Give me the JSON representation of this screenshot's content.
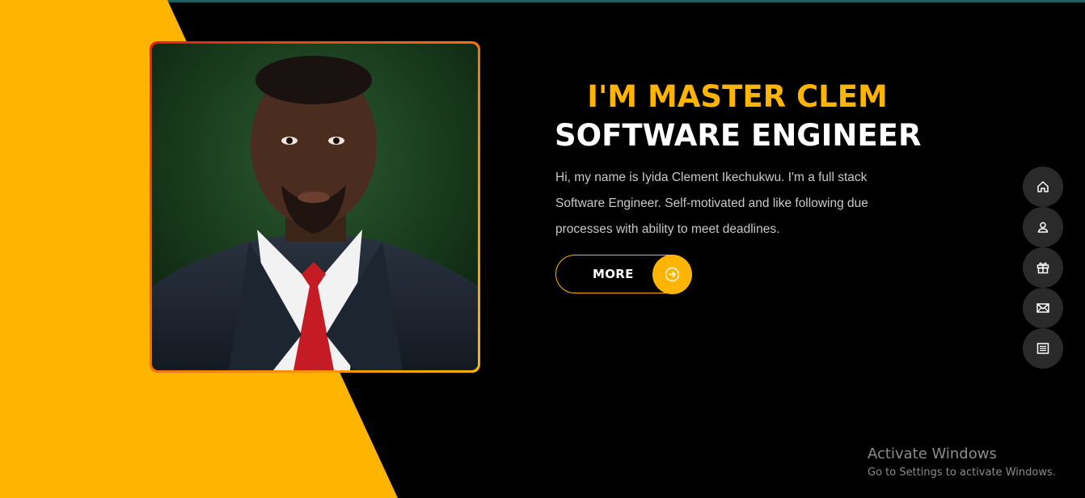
{
  "hero": {
    "greeting": "I'M MASTER CLEM",
    "role": "SOFTWARE ENGINEER",
    "bio": "Hi, my name is Iyida Clement Ikechukwu. I'm a full stack Software Engineer. Self-motivated and like following due processes with ability to meet deadlines.",
    "more_label": "MORE",
    "more_icon": "arrow-right-circle-icon",
    "photo": "portrait-photo"
  },
  "side_nav": {
    "items": [
      {
        "icon": "home-icon"
      },
      {
        "icon": "user-icon"
      },
      {
        "icon": "gift-icon"
      },
      {
        "icon": "mail-icon"
      },
      {
        "icon": "newspaper-icon"
      }
    ]
  },
  "watermark": {
    "title": "Activate Windows",
    "subtitle": "Go to Settings to activate Windows."
  },
  "colors": {
    "accent": "#ffb400",
    "background": "#000000",
    "nav_button": "#2b2a2a",
    "text_primary": "#ffffff",
    "text_body": "#c9c9c9"
  }
}
